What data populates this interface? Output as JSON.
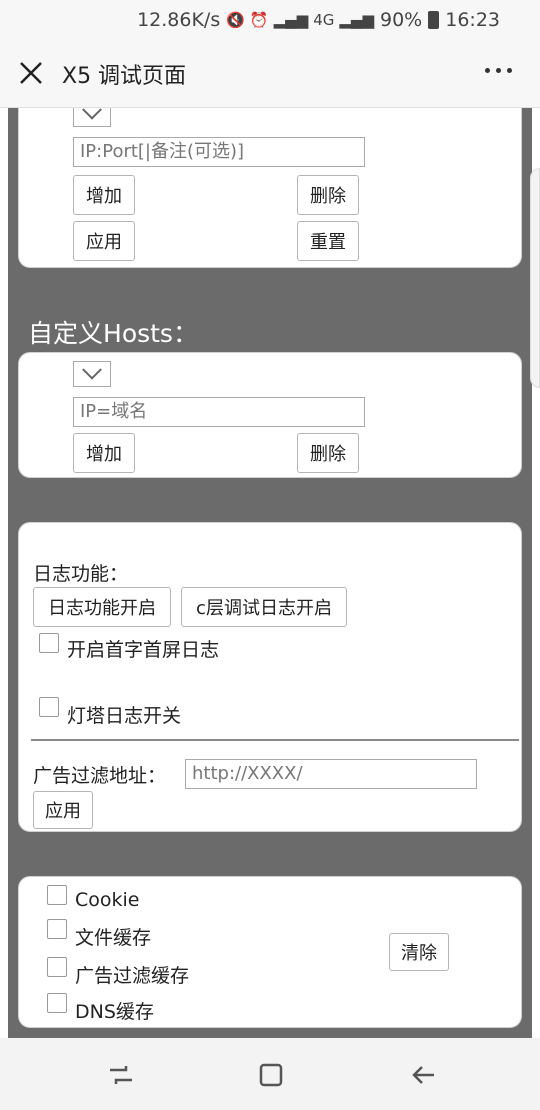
{
  "status_bar": {
    "speed": "12.86K/s",
    "network": "4G",
    "battery": "90%",
    "time": "16:23"
  },
  "title_bar": {
    "title": "X5 调试页面"
  },
  "proxy_panel": {
    "input_placeholder": "IP:Port[|备注(可选)]",
    "add_label": "增加",
    "delete_label": "删除",
    "apply_label": "应用",
    "reset_label": "重置"
  },
  "hosts_section": {
    "heading_prefix": "自定义",
    "heading_suffix": "Hosts：",
    "input_placeholder": "IP=域名",
    "add_label": "增加",
    "delete_label": "删除"
  },
  "log_panel": {
    "title": "日志功能：",
    "enable_log_label": "日志功能开启",
    "c_layer_log_label": "c层调试日志开启",
    "first_screen_label": "开启首字首屏日志",
    "lighthouse_label": "灯塔日志开关",
    "ad_filter_label": "广告过滤地址：",
    "ad_filter_placeholder": "http://XXXX/",
    "apply_label": "应用"
  },
  "cache_panel": {
    "options": [
      "Cookie",
      "文件缓存",
      "广告过滤缓存",
      "DNS缓存"
    ],
    "clear_label": "清除"
  }
}
